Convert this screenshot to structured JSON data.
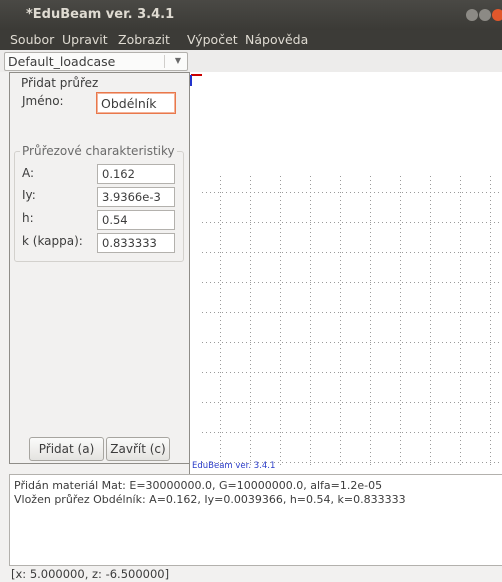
{
  "window": {
    "title": "*EduBeam ver. 3.4.1"
  },
  "menu": [
    "Soubor",
    "Upravit",
    "Zobrazit",
    "Výpočet",
    "Nápověda"
  ],
  "loadcase": {
    "selected": "Default_loadcase"
  },
  "dialog": {
    "title": "Přidat průřez",
    "name_label": "Jméno:",
    "name_value": "Obdélník",
    "section_title": "Průřezové charakteristiky",
    "fields": [
      {
        "label": "A:",
        "value": "0.162"
      },
      {
        "label": "Iy:",
        "value": "3.9366e-3"
      },
      {
        "label": "h:",
        "value": "0.54"
      },
      {
        "label": "k (kappa):",
        "value": "0.833333"
      }
    ],
    "add_button": "Přidat (a)",
    "close_button": "Zavřít (c)"
  },
  "canvas": {
    "watermark": "EduBeam ver. 3.4.1",
    "axis_color": "#cc0000",
    "axis_color_2": "#2233cc"
  },
  "log": [
    "Přidán materiál Mat: E=30000000.0, G=10000000.0, alfa=1.2e-05",
    "Vložen průřez Obdélník: A=0.162, Iy=0.0039366, h=0.54, k=0.833333"
  ],
  "status": "[x: 5.000000, z: -6.500000]"
}
